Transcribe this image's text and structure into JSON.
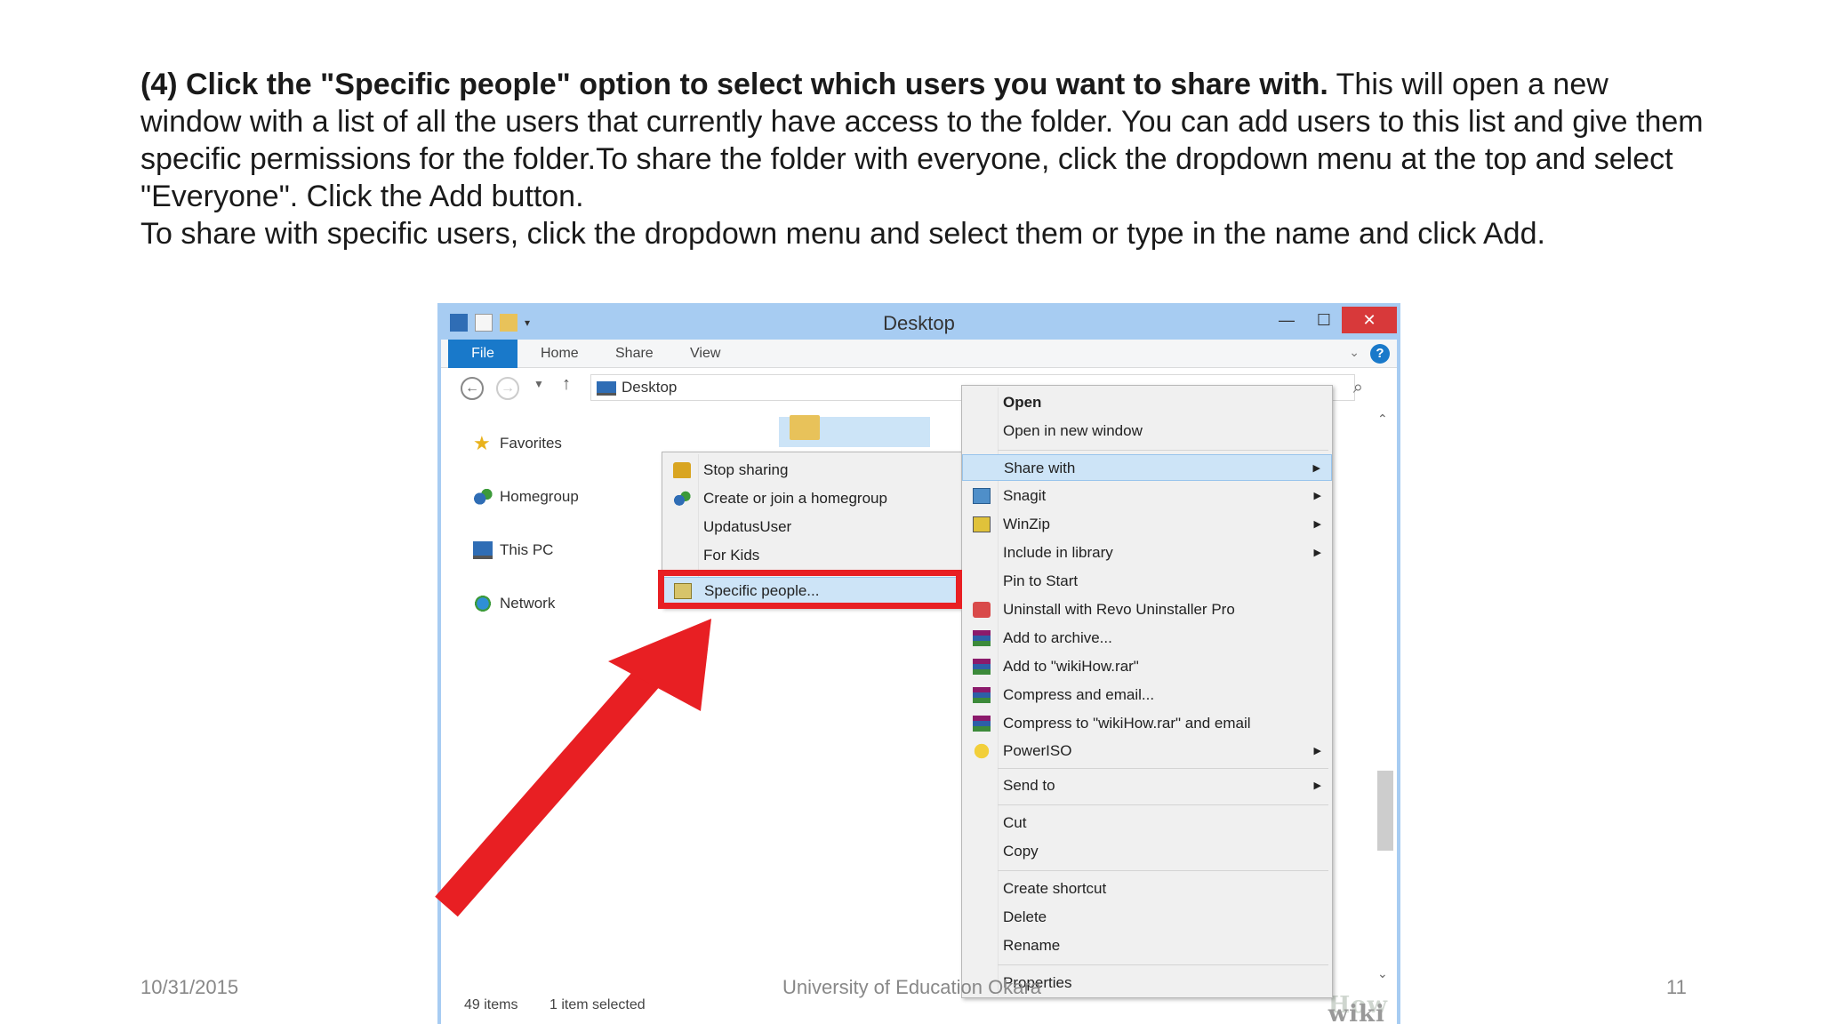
{
  "slide": {
    "instruction_bold": "(4) Click the \"Specific people\" option to select which users you want to share with.",
    "instruction_rest": " This will open a new window with a list of all the users that currently have access to the folder. You can add users to this list and give them specific permissions for the folder.To share the folder with everyone, click the dropdown menu at the top and select \"Everyone\". Click the Add button.",
    "instruction_line2": "To share with specific users, click the dropdown menu and select them or type in the name and click Add.",
    "date": "10/31/2015",
    "institution": "University of Education Okara",
    "page": "11"
  },
  "window": {
    "title": "Desktop",
    "tabs": {
      "file": "File",
      "home": "Home",
      "share": "Share",
      "view": "View"
    },
    "address": "Desktop",
    "nav": {
      "favorites": "Favorites",
      "homegroup": "Homegroup",
      "thispc": "This PC",
      "network": "Network"
    },
    "status": {
      "items": "49 items",
      "selected": "1 item selected"
    },
    "watermark": {
      "a": "wiki",
      "b": "How"
    }
  },
  "share_menu": {
    "stop_sharing": "Stop sharing",
    "homegroup": "Create or join a homegroup",
    "user1": "UpdatusUser",
    "user2": "For Kids",
    "specific": "Specific people..."
  },
  "context_menu": {
    "open": "Open",
    "open_new": "Open in new window",
    "share_with": "Share with",
    "snagit": "Snagit",
    "winzip": "WinZip",
    "include": "Include in library",
    "pin": "Pin to Start",
    "revo": "Uninstall with Revo Uninstaller Pro",
    "add_archive": "Add to archive...",
    "add_rar": "Add to \"wikiHow.rar\"",
    "compress": "Compress and email...",
    "compress_rar": "Compress to \"wikiHow.rar\" and email",
    "poweriso": "PowerISO",
    "send_to": "Send to",
    "cut": "Cut",
    "copy": "Copy",
    "shortcut": "Create shortcut",
    "delete": "Delete",
    "rename": "Rename",
    "properties": "Properties"
  },
  "colors": {
    "highlight_red": "#e81f23",
    "accent_blue": "#1979ca",
    "menu_bg": "#f0f0f0"
  }
}
